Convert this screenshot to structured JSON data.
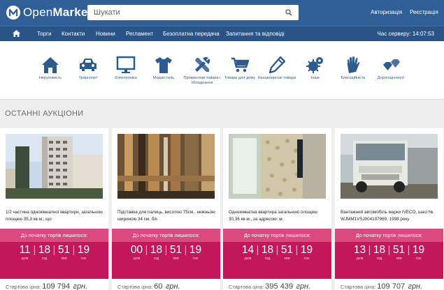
{
  "brand": {
    "name_light": "Open",
    "name_bold": "Market"
  },
  "search": {
    "placeholder": "Шукати"
  },
  "auth": {
    "login": "Авторизація",
    "register": "Реєстрація"
  },
  "nav": {
    "items": [
      "Торги",
      "Контакти",
      "Новини",
      "Регламент",
      "Безоплатна передача",
      "Запитання та відповіді"
    ],
    "server_time_label": "Час серверу: ",
    "server_time": "14:07:53"
  },
  "categories": [
    {
      "label": "Нерухомість",
      "icon": "house-icon"
    },
    {
      "label": "Транспорт",
      "icon": "car-icon"
    },
    {
      "label": "Електроніка",
      "icon": "monitor-icon"
    },
    {
      "label": "Мода/стиль",
      "icon": "tshirt-icon"
    },
    {
      "label": "Промислові товари і обладнання",
      "icon": "tools-icon"
    },
    {
      "label": "Товари для дому",
      "icon": "cart-icon"
    },
    {
      "label": "Канцелярські товари",
      "icon": "pencil-icon"
    },
    {
      "label": "Інше",
      "icon": "gears-icon"
    },
    {
      "label": "Благодійність",
      "icon": "hand-icon"
    },
    {
      "label": "Дорогоцінності",
      "icon": "gems-icon"
    }
  ],
  "section_title": "ОСТАННІ АУКЦІОНИ",
  "timer_header": "До початку торгів лишилося:",
  "units": {
    "days": "днів",
    "hours": "год",
    "minutes": "хви",
    "seconds": "сек"
  },
  "price_label": "Стартова ціна: ",
  "currency": "грн.",
  "colors": {
    "header": "#2f5f96",
    "nav": "#2a5388",
    "timer": "#c2185b",
    "timer_head": "#d84b7c",
    "link": "#2e5b8d"
  },
  "lots": [
    {
      "title": "1/2 частина однокімнатної квартири, загальною площею 35,3 кв.м., що",
      "days": "11",
      "hours": "18",
      "minutes": "51",
      "seconds": "19",
      "price": "109 794"
    },
    {
      "title": "Підставка для палиць, висотою 75см., нижньою шириною 34 см, б/к",
      "days": "00",
      "hours": "18",
      "minutes": "51",
      "seconds": "19",
      "price": "60"
    },
    {
      "title": "Однокімнатна квартира загальною площею 30,36 кв.м., за адресою: м.",
      "days": "14",
      "hours": "18",
      "minutes": "51",
      "seconds": "19",
      "price": "395 439"
    },
    {
      "title": "Вантажний автомобіль марки IVECO, шасі № WJMM1VSJ004197969, 1998 року",
      "days": "13",
      "hours": "18",
      "minutes": "51",
      "seconds": "19",
      "price": "109 707"
    }
  ]
}
